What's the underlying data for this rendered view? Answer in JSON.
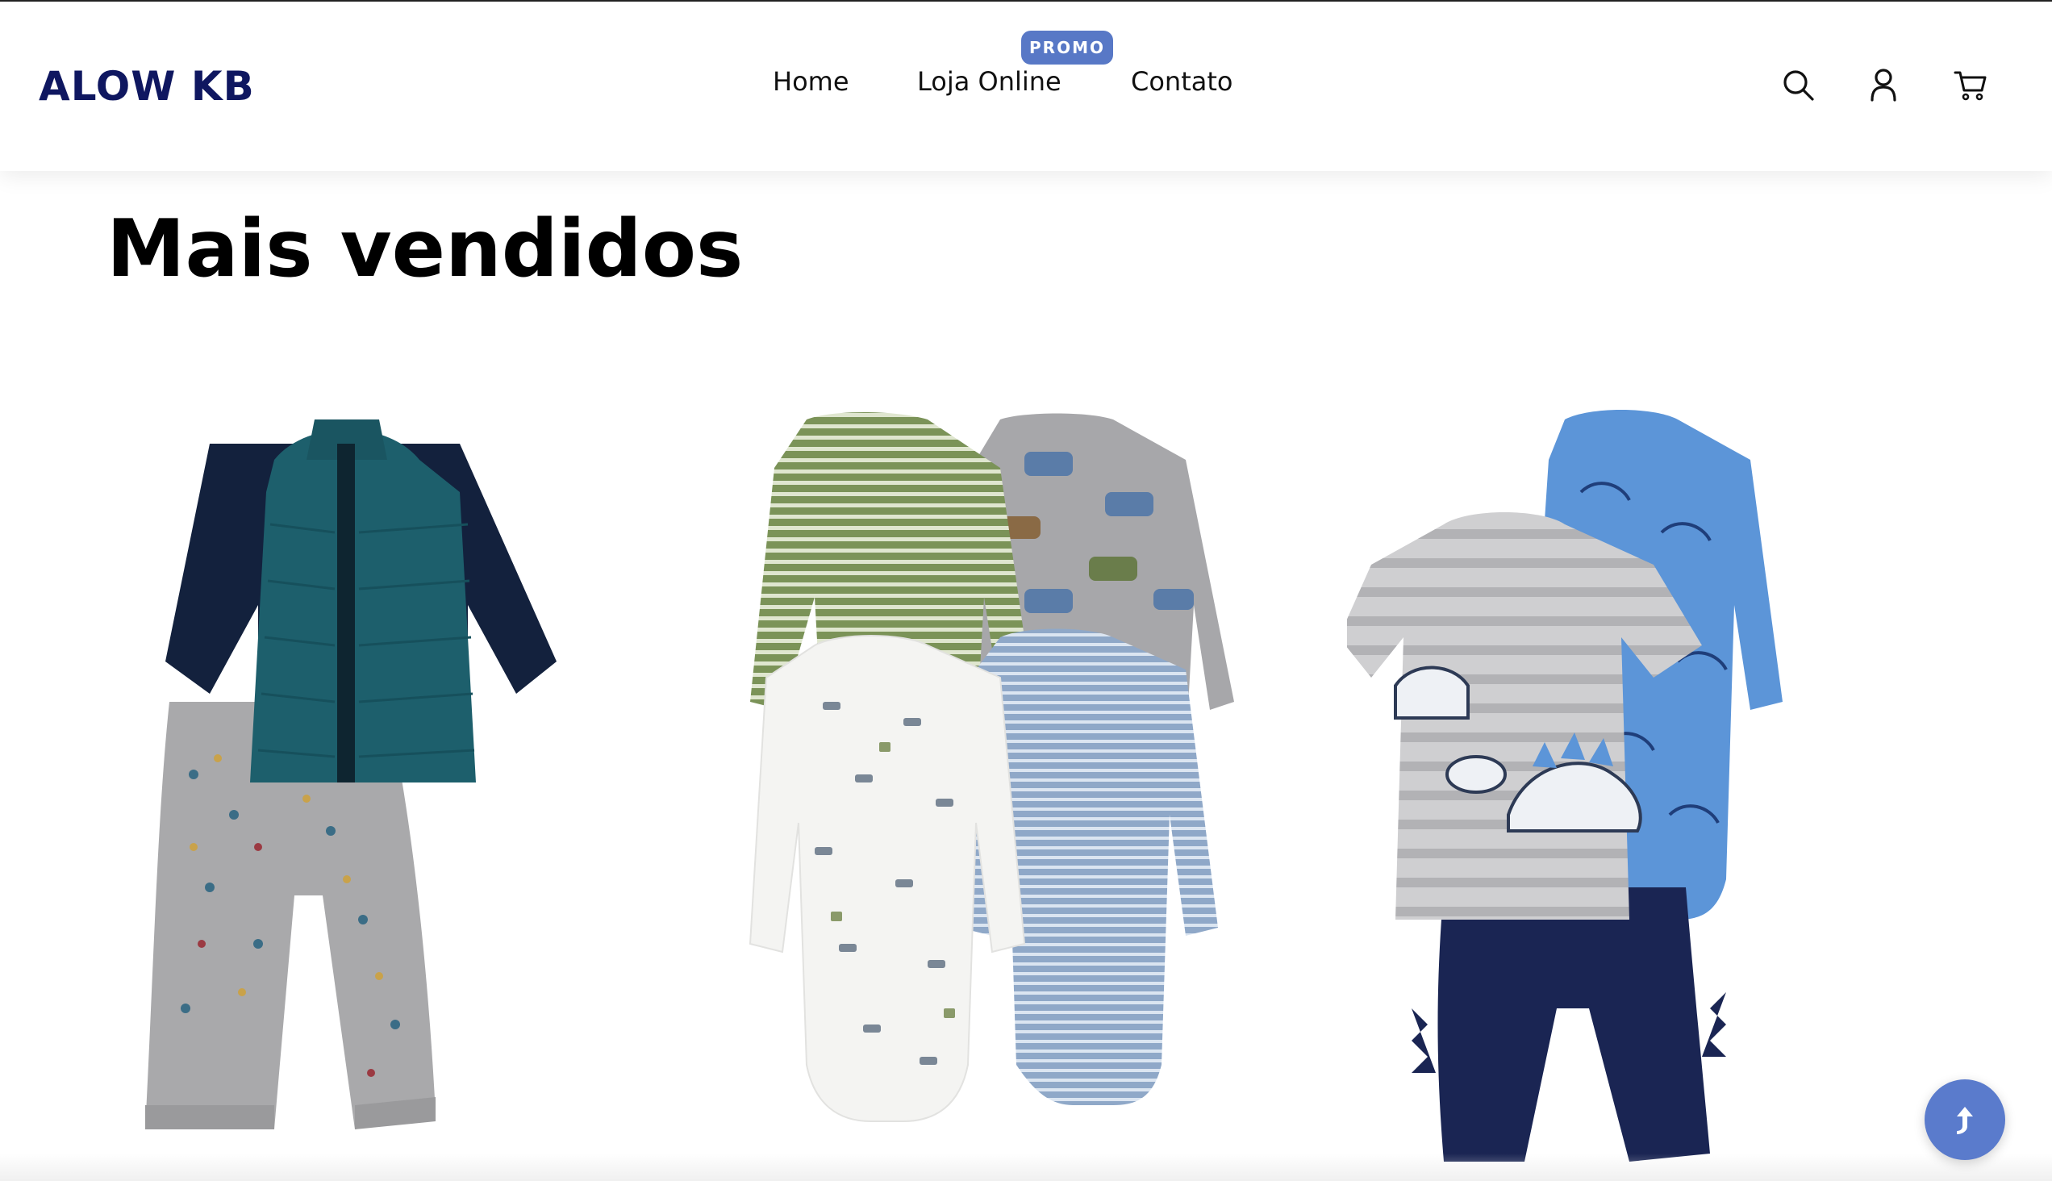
{
  "header": {
    "logo": "ALOW KB",
    "nav": [
      {
        "label": "Home"
      },
      {
        "label": "Loja Online"
      },
      {
        "label": "Contato"
      }
    ],
    "promo_badge": "PROMO",
    "icons": [
      "search-icon",
      "user-icon",
      "cart-icon"
    ]
  },
  "section": {
    "title": "Mais vendidos"
  },
  "products": [
    {
      "image": "vest-and-dino-pants-set"
    },
    {
      "image": "four-bodysuits-set"
    },
    {
      "image": "dino-tee-bodysuit-pants-set"
    }
  ],
  "scroll_top": {
    "icon": "arrow-up-icon"
  },
  "colors": {
    "logo": "#0f1760",
    "accent": "#5878c6",
    "scroll_button": "#5a7bcc"
  }
}
